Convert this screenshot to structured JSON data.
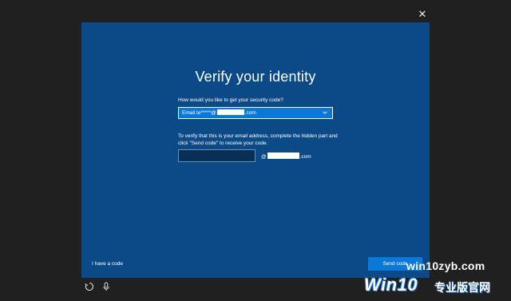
{
  "window": {
    "close_icon": "close-icon",
    "close_glyph": "✕"
  },
  "dialog": {
    "title": "Verify your identity",
    "question_label": "How would you like to get your security code?",
    "select": {
      "value_prefix": "Email te*****@",
      "value_suffix": ".com",
      "icon": "chevron-down-icon"
    },
    "verify_instructions": "To verify that this is your email address, complete the hidden part and click \"Send code\" to receive your code.",
    "email_input": {
      "value": "",
      "placeholder": ""
    },
    "domain": {
      "prefix": "@",
      "suffix": ".com"
    },
    "have_code_link": "I have a code",
    "send_button": "Send code"
  },
  "bottom_bar": {
    "ease_of_access_icon": "ease-of-access-icon",
    "microphone_icon": "microphone-icon"
  },
  "watermark": {
    "site": "win10zyb.com",
    "brand": "Win10",
    "sub": "专业版官网"
  },
  "colors": {
    "background": "#202020",
    "panel": "#0c4a87",
    "accent": "#0a78d7",
    "input_bg": "#082f56"
  }
}
